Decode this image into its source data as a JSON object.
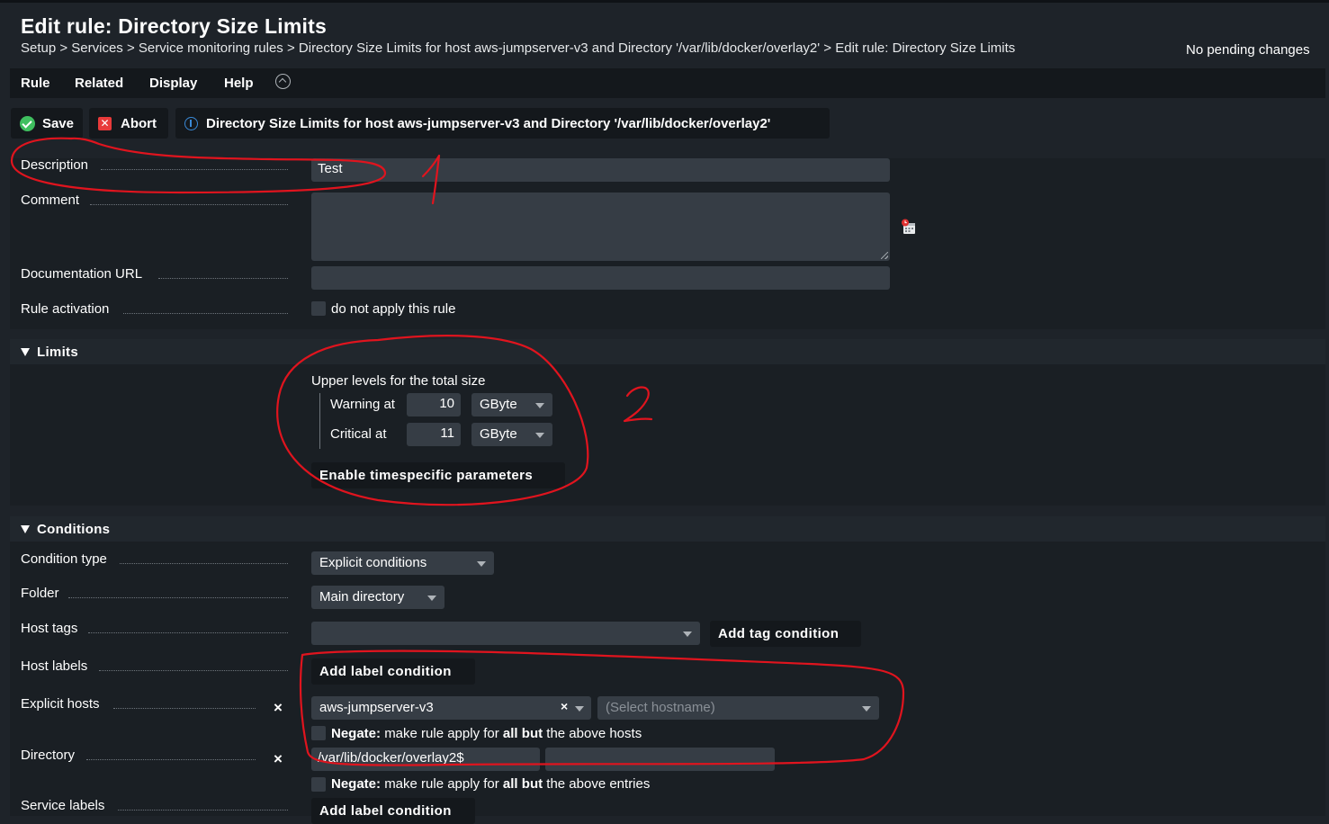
{
  "page": {
    "title": "Edit rule: Directory Size Limits",
    "breadcrumb": "Setup > Services > Service monitoring rules > Directory Size Limits for host aws-jumpserver-v3 and Directory '/var/lib/docker/overlay2' > Edit rule: Directory Size Limits",
    "pending": "No pending changes"
  },
  "menu": {
    "rule": "Rule",
    "related": "Related",
    "display": "Display",
    "help": "Help"
  },
  "toolbar": {
    "save": "Save",
    "abort": "Abort",
    "link": "Directory Size Limits for host aws-jumpserver-v3 and Directory '/var/lib/docker/overlay2'"
  },
  "rule_props": {
    "description_label": "Description",
    "description_value": "Test",
    "comment_label": "Comment",
    "doc_url_label": "Documentation URL",
    "activation_label": "Rule activation",
    "activation_text": "do not apply this rule"
  },
  "limits": {
    "header": "Limits",
    "upper_levels": "Upper levels for the total size",
    "warning_label": "Warning at",
    "warning_value": "10",
    "warning_unit": "GByte",
    "critical_label": "Critical at",
    "critical_value": "11",
    "critical_unit": "GByte",
    "timespecific": "Enable timespecific parameters"
  },
  "conditions": {
    "header": "Conditions",
    "condition_type_label": "Condition type",
    "condition_type_value": "Explicit conditions",
    "folder_label": "Folder",
    "folder_value": "Main directory",
    "host_tags_label": "Host tags",
    "add_tag": "Add tag condition",
    "host_labels_label": "Host labels",
    "add_label": "Add label condition",
    "explicit_hosts_label": "Explicit hosts",
    "host_value": "aws-jumpserver-v3",
    "host_placeholder": "(Select hostname)",
    "negate_bold": "Negate:",
    "negate_hosts_pre": "make rule apply for",
    "negate_all": "all",
    "negate_but": "but",
    "negate_hosts_post": "the above hosts",
    "directory_label": "Directory",
    "directory_value": "/var/lib/docker/overlay2$",
    "negate_entries_post": "the above entries",
    "service_labels_label": "Service labels",
    "add_label_2": "Add label condition"
  },
  "annotations": {
    "mark1": "1",
    "mark2": "2"
  },
  "colors": {
    "background": "#1e2329",
    "input": "#363d45",
    "button": "#14181c",
    "annotation": "#e0141e"
  }
}
